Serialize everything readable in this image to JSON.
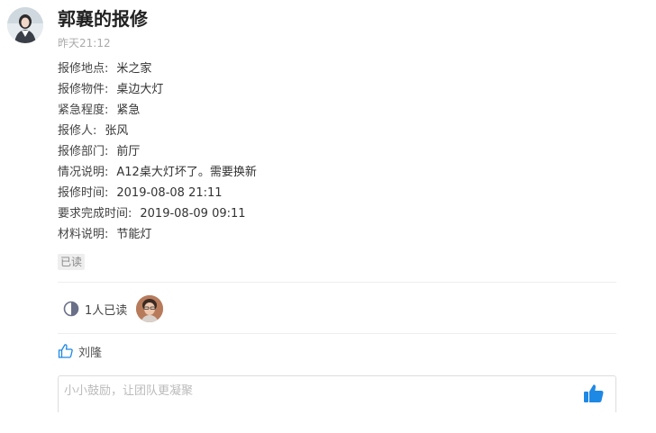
{
  "post": {
    "title": "郭襄的报修",
    "time": "昨天21:12"
  },
  "fields": [
    {
      "label": "报修地点:",
      "value": "米之家"
    },
    {
      "label": "报修物件:",
      "value": "桌边大灯"
    },
    {
      "label": "紧急程度:",
      "value": "紧急"
    },
    {
      "label": "报修人:",
      "value": "张风"
    },
    {
      "label": "报修部门:",
      "value": "前厅"
    },
    {
      "label": "情况说明:",
      "value": "A12桌大灯坏了。需要换新"
    },
    {
      "label": "报修时间:",
      "value": "2019-08-08 21:11"
    },
    {
      "label": "要求完成时间:",
      "value": "2019-08-09 09:11"
    },
    {
      "label": "材料说明:",
      "value": "节能灯"
    }
  ],
  "badge": {
    "read": "已读"
  },
  "readers": {
    "count_text": "1人已读"
  },
  "likes": {
    "name": "刘隆"
  },
  "comment": {
    "placeholder": "小小鼓励，让团队更凝聚"
  },
  "colors": {
    "accent_blue": "#1e88e5",
    "icon_gray": "#6b7089",
    "divider": "#ededed"
  },
  "icons": {
    "read_status": "half-circle-icon",
    "like": "thumbs-up-outline-icon",
    "send_like": "thumbs-up-filled-icon"
  }
}
